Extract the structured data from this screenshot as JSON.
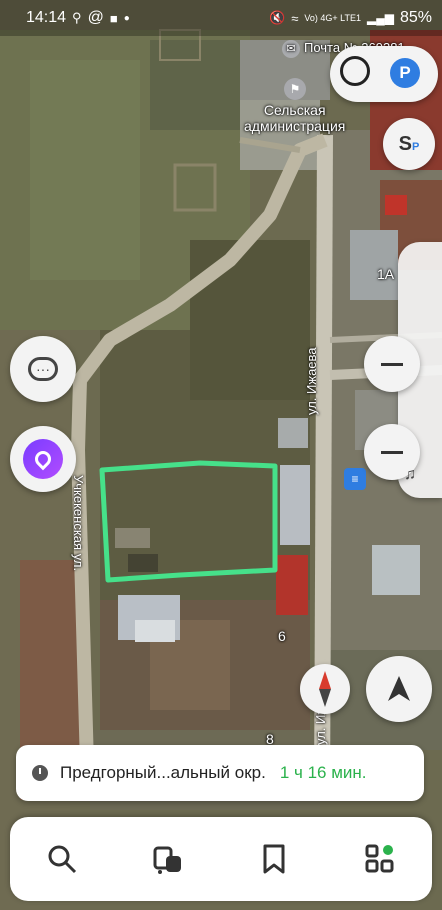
{
  "status": {
    "time": "14:14",
    "network": "Vo) 4G+ LTE1",
    "battery": "85%"
  },
  "map": {
    "poi_post": "Почта № 369381",
    "poi_admin_line1": "Сельская",
    "poi_admin_line2": "администрация",
    "house_1a": "1А",
    "house_5": "5",
    "house_6": "6",
    "house_8": "8",
    "street_izhaeva": "ул. Ижаева",
    "street_izhaeva_short": "ул. Иж",
    "street_uchkeken": "Учкекенская ул."
  },
  "route": {
    "destination": "Предгорный...альный окр.",
    "duration": "1 ч 16 мин.",
    "duration_color": "#2bb24c"
  },
  "nav": {
    "items": [
      "search-icon",
      "transport-icon",
      "bookmarks-icon",
      "services-icon"
    ]
  },
  "colors": {
    "accent": "#2f7de1",
    "highlight": "#46e08a"
  }
}
